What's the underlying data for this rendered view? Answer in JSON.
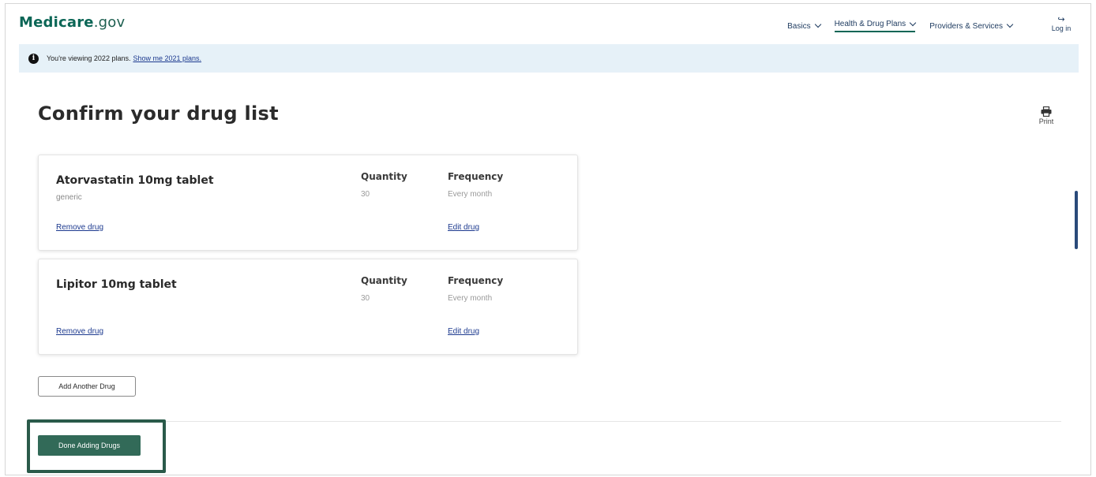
{
  "header": {
    "logo_brand": "Medicare",
    "logo_tld": ".gov",
    "nav": [
      {
        "label": "Basics"
      },
      {
        "label": "Health & Drug Plans"
      },
      {
        "label": "Providers & Services"
      }
    ],
    "login_label": "Log in"
  },
  "banner": {
    "text": "You're viewing 2022 plans.",
    "link": "Show me 2021 plans."
  },
  "page": {
    "title": "Confirm your drug list",
    "print_label": "Print"
  },
  "drugs": [
    {
      "name": "Atorvastatin 10mg tablet",
      "type": "generic",
      "quantity_label": "Quantity",
      "quantity": "30",
      "frequency_label": "Frequency",
      "frequency": "Every month",
      "remove_label": "Remove drug",
      "edit_label": "Edit drug"
    },
    {
      "name": "Lipitor 10mg tablet",
      "type": "",
      "quantity_label": "Quantity",
      "quantity": "30",
      "frequency_label": "Frequency",
      "frequency": "Every month",
      "remove_label": "Remove drug",
      "edit_label": "Edit drug"
    }
  ],
  "actions": {
    "add_label": "Add Another Drug",
    "done_label": "Done Adding Drugs"
  },
  "colors": {
    "brand": "#0b6656",
    "primary_button": "#326a58",
    "banner_bg": "#e6f1f8",
    "link": "#1d3a8f"
  }
}
